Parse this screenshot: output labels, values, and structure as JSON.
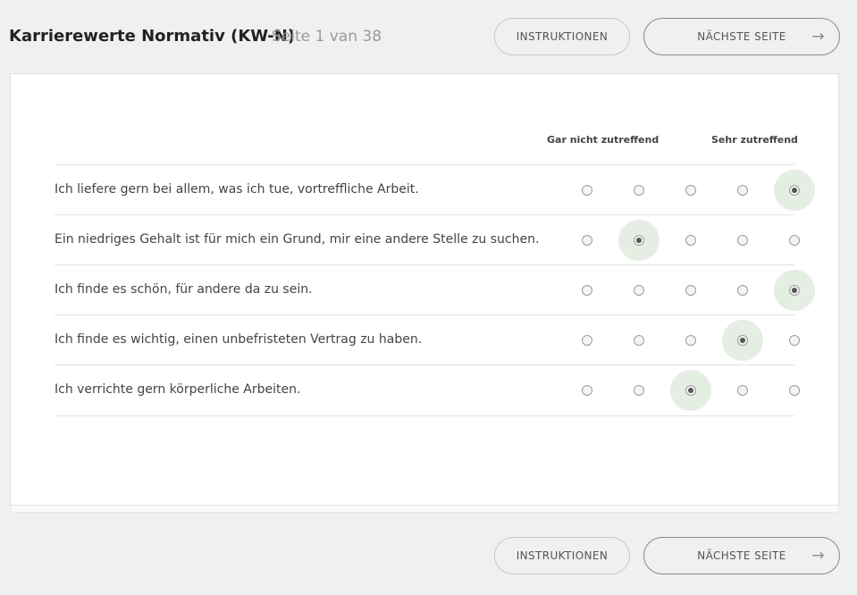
{
  "header": {
    "title": "Karrierewerte Normativ (KW-N)",
    "page_indicator": "Seite 1 van 38"
  },
  "buttons": {
    "instructions": "INSTRUKTIONEN",
    "next": "NÄCHSTE SEITE",
    "next_icon": "arrow-right-icon"
  },
  "scale": {
    "low_label": "Gar nicht zutreffend",
    "high_label": "Sehr zutreffend",
    "options": 5
  },
  "questions": [
    {
      "text": "Ich liefere gern bei allem, was ich tue, vortreffliche Arbeit.",
      "selected": 5
    },
    {
      "text": "Ein niedriges Gehalt ist für mich ein Grund, mir eine andere Stelle zu suchen.",
      "selected": 2
    },
    {
      "text": "Ich finde es schön, für andere da zu sein.",
      "selected": 5
    },
    {
      "text": "Ich finde es wichtig, einen unbefristeten Vertrag zu haben.",
      "selected": 4
    },
    {
      "text": "Ich verrichte gern körperliche Arbeiten.",
      "selected": 3
    }
  ],
  "colors": {
    "selected_highlight": "#e5eee3",
    "background": "#f0f0f0"
  }
}
